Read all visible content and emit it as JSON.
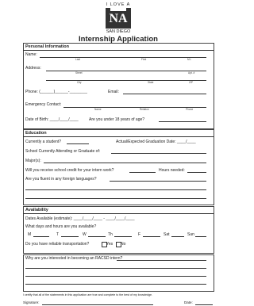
{
  "logo": {
    "top": "I LOVE A",
    "mark": "NA",
    "bottom": "SAN DIEGO"
  },
  "title": "Internship Application",
  "personal": {
    "heading": "Personal Information",
    "name_label": "Name:",
    "name_sub": {
      "last": "Last",
      "first": "First",
      "mi": "M.I."
    },
    "address_label": "Address:",
    "address_sub": {
      "street": "Street",
      "apt": "Apt. #",
      "city": "City",
      "state": "State",
      "zip": "ZIP"
    },
    "phone_label": "Phone: (______)______-________",
    "email_label": "Email:",
    "emergency_label": "Emergency Contact:",
    "emergency_sub": {
      "name": "Name",
      "relation": "Relation",
      "phone": "Phone"
    },
    "dob_label": "Date of Birth: ____/____/____",
    "age_label": "Are you under 18 years of age?"
  },
  "education": {
    "heading": "Education",
    "student_label": "Currently a student?",
    "grad_label": "Actual/Expected Graduation Date: ____/____",
    "school_label": "School Currently Attending or Graduate of:",
    "major_label": "Major(s):",
    "credit_label": "Will you receive school credit for your intern work?",
    "hours_label": "Hours needed:",
    "languages_label": "Are you fluent in any foreign languages?"
  },
  "availability": {
    "heading": "Availability",
    "dates_label": "Dates Available (estimate): ____/____/____ - ____/____/____",
    "days_label": "What days and hours are you available?",
    "days": [
      "M",
      "T",
      "W",
      "Th",
      "F",
      "Sat",
      "Sun"
    ],
    "transport_label": "Do you have reliable transportation?",
    "yes": "Yes",
    "no": "No"
  },
  "interest": {
    "label": "Why are you interested in becoming an RACSD intern?"
  },
  "certify": "I certify that all of the statements in this application are true and complete to the best of my knowledge.",
  "signature_label": "Signature:",
  "date_label": "Date:"
}
